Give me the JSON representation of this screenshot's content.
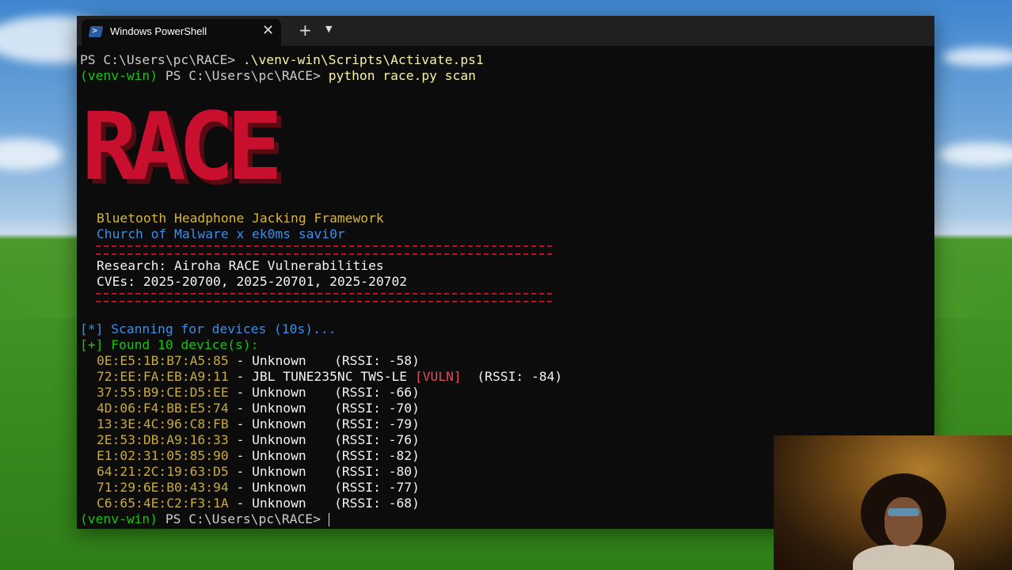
{
  "window": {
    "tab_title": "Windows PowerShell",
    "tab_close": "✕",
    "new_tab": "+",
    "dropdown": "⌄"
  },
  "terminal": {
    "prompt1_ps": "PS C:\\Users\\pc\\RACE> ",
    "prompt1_cmd": ".\\venv-win\\Scripts\\Activate.ps1",
    "prompt2_venv": "(venv-win) ",
    "prompt2_ps": "PS C:\\Users\\pc\\RACE> ",
    "prompt2_cmd": "python race.py scan",
    "banner_text": "RACE",
    "subtitle1": "Bluetooth Headphone Jacking Framework",
    "subtitle2": "Church of Malware x ek0ms savi0r",
    "research": "Research: Airoha RACE Vulnerabilities",
    "cves": "CVEs: 2025-20700, 2025-20701, 2025-20702",
    "scan_status": "[*] Scanning for devices (10s)...",
    "found_status": "[+] Found 10 device(s):",
    "devices": [
      {
        "mac": "0E:E5:1B:B7:A5:85",
        "sep": " - ",
        "name": "Unknown",
        "vuln": "",
        "rssi": "(RSSI: -58)"
      },
      {
        "mac": "72:EE:FA:EB:A9:11",
        "sep": " - ",
        "name": "JBL TUNE235NC TWS-LE",
        "vuln": "[VULN]",
        "rssi": "(RSSI: -84)"
      },
      {
        "mac": "37:55:B9:CE:D5:EE",
        "sep": " - ",
        "name": "Unknown",
        "vuln": "",
        "rssi": "(RSSI: -66)"
      },
      {
        "mac": "4D:06:F4:BB:E5:74",
        "sep": " - ",
        "name": "Unknown",
        "vuln": "",
        "rssi": "(RSSI: -70)"
      },
      {
        "mac": "13:3E:4C:96:C8:FB",
        "sep": " - ",
        "name": "Unknown",
        "vuln": "",
        "rssi": "(RSSI: -79)"
      },
      {
        "mac": "2E:53:DB:A9:16:33",
        "sep": " - ",
        "name": "Unknown",
        "vuln": "",
        "rssi": "(RSSI: -76)"
      },
      {
        "mac": "E1:02:31:05:85:90",
        "sep": " - ",
        "name": "Unknown",
        "vuln": "",
        "rssi": "(RSSI: -82)"
      },
      {
        "mac": "64:21:2C:19:63:D5",
        "sep": " - ",
        "name": "Unknown",
        "vuln": "",
        "rssi": "(RSSI: -80)"
      },
      {
        "mac": "71:29:6E:B0:43:94",
        "sep": " - ",
        "name": "Unknown",
        "vuln": "",
        "rssi": "(RSSI: -77)"
      },
      {
        "mac": "C6:65:4E:C2:F3:1A",
        "sep": " - ",
        "name": "Unknown",
        "vuln": "",
        "rssi": "(RSSI: -68)"
      }
    ],
    "final_venv": "(venv-win) ",
    "final_ps": "PS C:\\Users\\pc\\RACE> "
  },
  "colors": {
    "terminal_bg": "#0c0c0c",
    "banner_red": "#c8102e",
    "accent_yellow": "#d8b53a",
    "accent_blue": "#3b8eea",
    "accent_green": "#16c60c",
    "vuln_red": "#e74856"
  },
  "icons": {
    "tab_icon": "powershell-icon",
    "close": "close-icon",
    "add": "plus-icon",
    "more": "chevron-down-icon"
  }
}
